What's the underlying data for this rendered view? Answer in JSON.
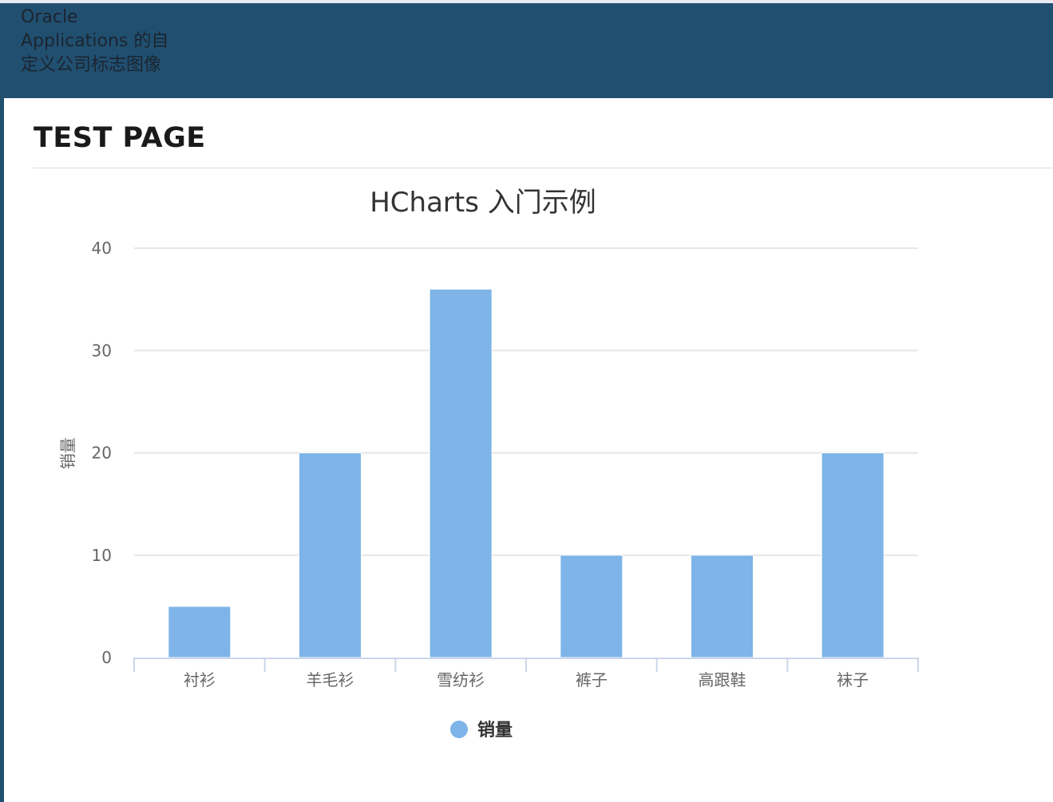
{
  "header": {
    "logo_alt_text": "Oracle Applications 的自定义公司标志图像"
  },
  "page": {
    "title": "TEST PAGE"
  },
  "chart_data": {
    "type": "bar",
    "title": "HCharts 入门示例",
    "xlabel": "",
    "ylabel": "销量",
    "categories": [
      "衬衫",
      "羊毛衫",
      "雪纺衫",
      "裤子",
      "高跟鞋",
      "袜子"
    ],
    "series": [
      {
        "name": "销量",
        "values": [
          5,
          20,
          36,
          10,
          10,
          20
        ]
      }
    ],
    "ylim": [
      0,
      40
    ],
    "yticks": [
      0,
      10,
      20,
      30,
      40
    ],
    "grid": true,
    "legend_position": "bottom-center",
    "colors": {
      "bar": "#7eb4e7",
      "grid": "#e6e6e6",
      "axis": "#ccd6eb",
      "tick_label": "#666666",
      "title": "#333333"
    }
  }
}
